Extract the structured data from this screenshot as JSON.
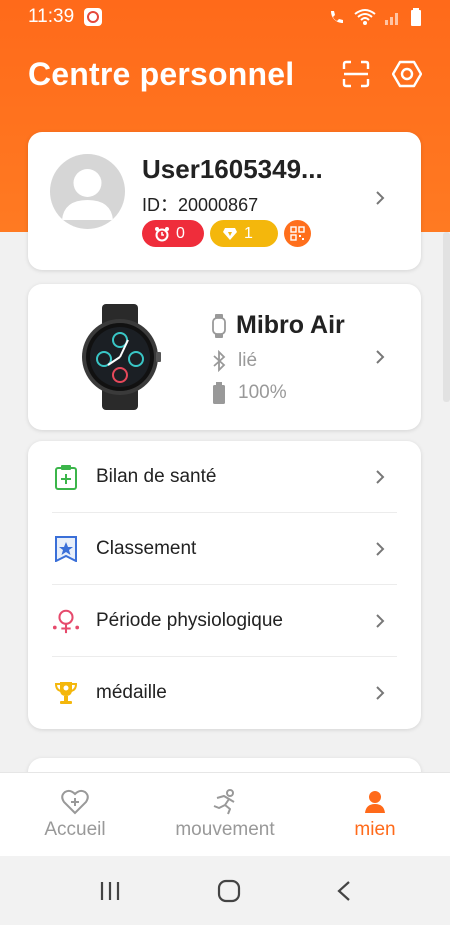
{
  "status": {
    "time": "11:39",
    "icons": [
      "app-notification-icon",
      "wifi-call-icon",
      "wifi-icon",
      "signal-icon",
      "battery-icon"
    ]
  },
  "header": {
    "title": "Centre personnel",
    "icons": [
      "scan-icon",
      "settings-icon"
    ]
  },
  "profile": {
    "username": "User1605349...",
    "id": "ID：20000867",
    "alarm_count": "0",
    "gem_count": "1"
  },
  "device": {
    "name": "Mibro Air",
    "status": "lié",
    "battery": "100%"
  },
  "menu": {
    "items": [
      {
        "label": "Bilan de santé",
        "icon": "health-report-icon"
      },
      {
        "label": "Classement",
        "icon": "ranking-icon"
      },
      {
        "label": "Période physiologique",
        "icon": "female-cycle-icon"
      },
      {
        "label": "médaille",
        "icon": "trophy-icon"
      }
    ]
  },
  "nav": {
    "items": [
      {
        "label": "Accueil",
        "icon": "heart-home-icon",
        "active": false
      },
      {
        "label": "mouvement",
        "icon": "running-icon",
        "active": false
      },
      {
        "label": "mien",
        "icon": "person-icon",
        "active": true
      }
    ]
  },
  "colors": {
    "accent": "#ff6a1a",
    "badge_red": "#ef2d3b",
    "badge_yellow": "#f4b70c"
  }
}
